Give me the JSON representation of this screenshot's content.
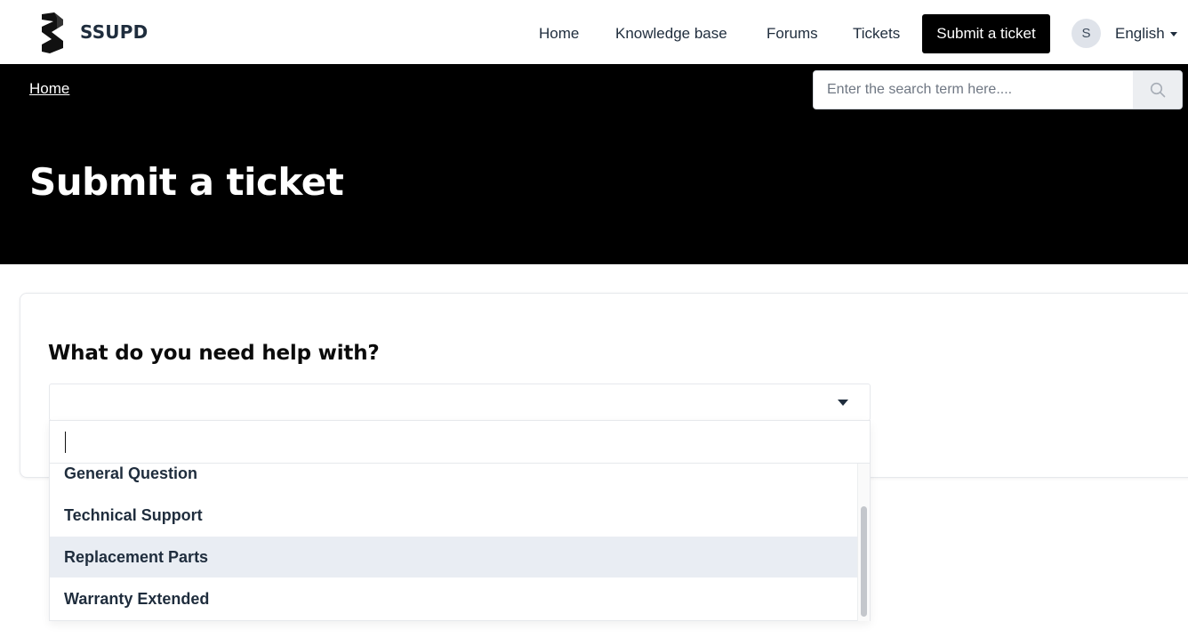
{
  "brand": {
    "name": "SSUPD"
  },
  "nav": {
    "home": "Home",
    "knowledge_base": "Knowledge base",
    "forums": "Forums",
    "tickets": "Tickets",
    "submit_ticket": "Submit a ticket"
  },
  "user": {
    "avatar_initial": "S",
    "language": "English"
  },
  "hero": {
    "breadcrumb": "Home",
    "title": "Submit a ticket",
    "search_placeholder": "Enter the search term here...."
  },
  "form": {
    "question": "What do you need help with?",
    "selected_value": "",
    "dropdown_filter": "",
    "options": [
      {
        "label": "General Question",
        "highlighted": false
      },
      {
        "label": "Technical Support",
        "highlighted": false
      },
      {
        "label": "Replacement Parts",
        "highlighted": true
      },
      {
        "label": "Warranty Extended",
        "highlighted": false
      }
    ]
  },
  "colors": {
    "hero_bg": "#000000",
    "text_dark": "#1f2d3d",
    "highlight_bg": "#e9edf3",
    "button_bg": "#000000"
  },
  "icons": [
    "logo-icon",
    "search-icon",
    "chevron-down-icon"
  ]
}
